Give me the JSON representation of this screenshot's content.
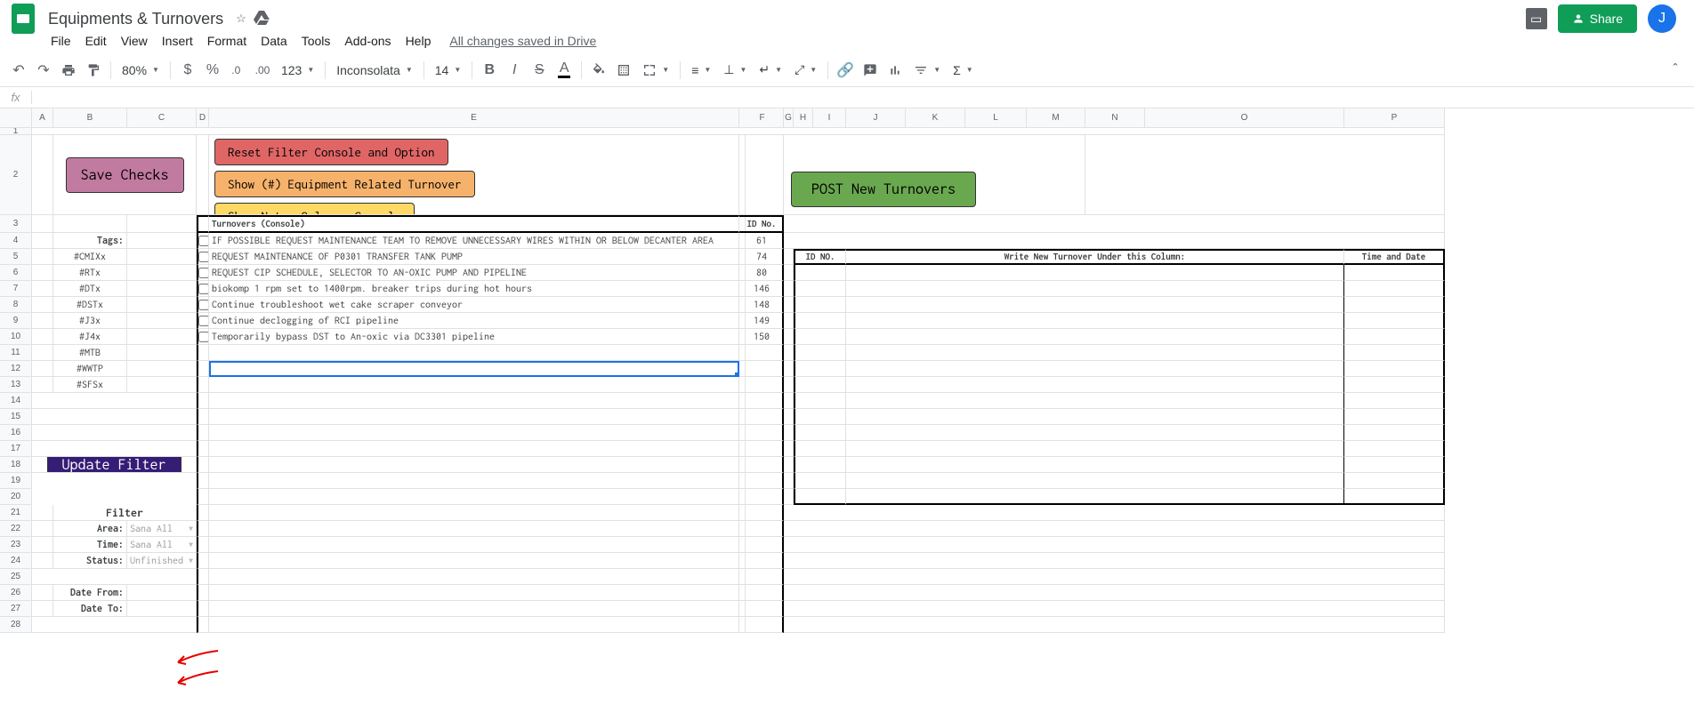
{
  "doc": {
    "title": "Equipments & Turnovers"
  },
  "menu": [
    "File",
    "Edit",
    "View",
    "Insert",
    "Format",
    "Data",
    "Tools",
    "Add-ons",
    "Help"
  ],
  "saved_status": "All changes saved in Drive",
  "share_label": "Share",
  "avatar_letter": "J",
  "toolbar": {
    "zoom": "80%",
    "font": "Inconsolata",
    "font_size": "14",
    "format_123": "123"
  },
  "col_headers": [
    "A",
    "B",
    "C",
    "D",
    "E",
    "",
    "F",
    "G",
    "H",
    "I",
    "J",
    "K",
    "L",
    "M",
    "N",
    "O",
    "P"
  ],
  "row_headers": [
    "1",
    "2",
    "3",
    "4",
    "5",
    "6",
    "7",
    "8",
    "9",
    "10",
    "11",
    "12",
    "13",
    "14",
    "15",
    "16",
    "17",
    "18",
    "19",
    "20",
    "21",
    "22",
    "23",
    "24",
    "25",
    "26",
    "27",
    "28"
  ],
  "buttons": {
    "save": "Save Checks",
    "reset": "Reset Filter Console and Option",
    "show_eq": "Show (#) Equipment Related Turnover",
    "show_notes": "Show Notes Only on Console",
    "update": "Update Filter",
    "post": "POST New Turnovers"
  },
  "tags_label": "Tags:",
  "tags": [
    "#CMIXx",
    "#RTx",
    "#DTx",
    "#DSTx",
    "#J3x",
    "#J4x",
    "#MTB",
    "#WWTP",
    "#SFSx"
  ],
  "turnover_header": {
    "title": "Turnovers (Console)",
    "id": "ID No."
  },
  "turnovers": [
    {
      "text": "IF POSSIBLE REQUEST MAINTENANCE TEAM TO REMOVE UNNECESSARY WIRES WITHIN OR BELOW DECANTER AREA",
      "id": "61"
    },
    {
      "text": "REQUEST MAINTENANCE OF P0301 TRANSFER TANK PUMP",
      "id": "74"
    },
    {
      "text": "REQUEST CIP SCHEDULE, SELECTOR TO AN-OXIC PUMP AND PIPELINE",
      "id": "80"
    },
    {
      "text": "biokomp 1 rpm set to 1400rpm. breaker trips during hot hours",
      "id": "146"
    },
    {
      "text": "Continue troubleshoot wet cake scraper conveyor",
      "id": "148"
    },
    {
      "text": "Continue declogging of RCI pipeline",
      "id": "149"
    },
    {
      "text": "Temporarily bypass DST to An-oxic via DC3301 pipeline",
      "id": "150"
    }
  ],
  "filter": {
    "title": "Filter",
    "area_label": "Area:",
    "area_value": "Sana All",
    "time_label": "Time:",
    "time_value": "Sana All",
    "status_label": "Status:",
    "status_value": "Unfinished",
    "date_from": "Date From:",
    "date_to": "Date To:"
  },
  "new_turnover": {
    "id": "ID NO.",
    "write": "Write New Turnover Under this Column:",
    "time": "Time and Date"
  }
}
